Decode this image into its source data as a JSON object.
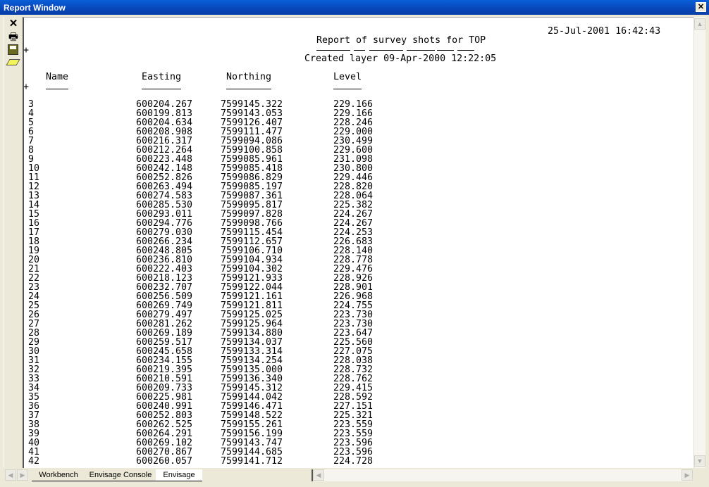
{
  "window": {
    "title": "Report Window",
    "close": "✕"
  },
  "toolbar": [
    {
      "name": "close",
      "icon": "✕"
    },
    {
      "name": "print",
      "icon": "🖶"
    },
    {
      "name": "save",
      "icon": "💾"
    },
    {
      "name": "erase",
      "icon": "⌫"
    }
  ],
  "report": {
    "timestamp": "25-Jul-2001 16:42:43",
    "title": "Report of survey shots for TOP",
    "subtitle": "Created layer 09-Apr-2000 12:22:05",
    "marker": "+",
    "columns": [
      "Name",
      "Easting",
      "Northing",
      "Level"
    ],
    "rows": [
      [
        "3",
        "600204.267",
        "7599145.322",
        "229.166"
      ],
      [
        "4",
        "600199.813",
        "7599143.053",
        "229.166"
      ],
      [
        "5",
        "600204.634",
        "7599126.407",
        "228.246"
      ],
      [
        "6",
        "600208.908",
        "7599111.477",
        "229.000"
      ],
      [
        "7",
        "600216.317",
        "7599094.086",
        "230.499"
      ],
      [
        "8",
        "600212.264",
        "7599100.858",
        "229.600"
      ],
      [
        "9",
        "600223.448",
        "7599085.961",
        "231.098"
      ],
      [
        "10",
        "600242.148",
        "7599085.418",
        "230.800"
      ],
      [
        "11",
        "600252.826",
        "7599086.829",
        "229.446"
      ],
      [
        "12",
        "600263.494",
        "7599085.197",
        "228.820"
      ],
      [
        "13",
        "600274.583",
        "7599087.361",
        "228.064"
      ],
      [
        "14",
        "600285.530",
        "7599095.817",
        "225.382"
      ],
      [
        "15",
        "600293.011",
        "7599097.828",
        "224.267"
      ],
      [
        "16",
        "600294.776",
        "7599098.766",
        "224.267"
      ],
      [
        "17",
        "600279.030",
        "7599115.454",
        "224.253"
      ],
      [
        "18",
        "600266.234",
        "7599112.657",
        "226.683"
      ],
      [
        "19",
        "600248.805",
        "7599106.710",
        "228.140"
      ],
      [
        "20",
        "600236.810",
        "7599104.934",
        "228.778"
      ],
      [
        "21",
        "600222.403",
        "7599104.302",
        "229.476"
      ],
      [
        "22",
        "600218.123",
        "7599121.933",
        "228.926"
      ],
      [
        "23",
        "600232.707",
        "7599122.044",
        "228.901"
      ],
      [
        "24",
        "600256.509",
        "7599121.161",
        "226.968"
      ],
      [
        "25",
        "600269.749",
        "7599121.811",
        "224.755"
      ],
      [
        "26",
        "600279.497",
        "7599125.025",
        "223.730"
      ],
      [
        "27",
        "600281.262",
        "7599125.964",
        "223.730"
      ],
      [
        "28",
        "600269.189",
        "7599134.880",
        "223.647"
      ],
      [
        "29",
        "600259.517",
        "7599134.037",
        "225.560"
      ],
      [
        "30",
        "600245.658",
        "7599133.314",
        "227.075"
      ],
      [
        "31",
        "600234.155",
        "7599134.254",
        "228.038"
      ],
      [
        "32",
        "600219.395",
        "7599135.000",
        "228.732"
      ],
      [
        "33",
        "600210.591",
        "7599136.340",
        "228.762"
      ],
      [
        "34",
        "600209.733",
        "7599145.312",
        "229.415"
      ],
      [
        "35",
        "600225.981",
        "7599144.042",
        "228.592"
      ],
      [
        "36",
        "600240.991",
        "7599146.471",
        "227.151"
      ],
      [
        "37",
        "600252.803",
        "7599148.522",
        "225.321"
      ],
      [
        "38",
        "600262.525",
        "7599155.261",
        "223.559"
      ],
      [
        "39",
        "600264.291",
        "7599156.199",
        "223.559"
      ],
      [
        "40",
        "600269.102",
        "7599143.747",
        "223.596"
      ],
      [
        "41",
        "600270.867",
        "7599144.685",
        "223.596"
      ],
      [
        "42",
        "600260.057",
        "7599141.712",
        "224.728"
      ]
    ]
  },
  "tabs": [
    "Workbench",
    "Envisage Console",
    "Envisage"
  ],
  "active_tab": 2
}
